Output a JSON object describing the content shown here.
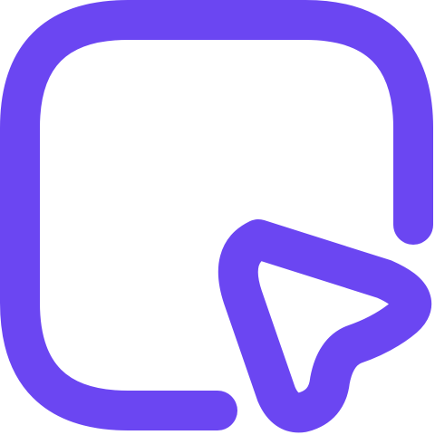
{
  "icon": {
    "name": "square-cursor-icon",
    "stroke_color": "#6B46F2",
    "background_color": "#FFFFFF"
  }
}
